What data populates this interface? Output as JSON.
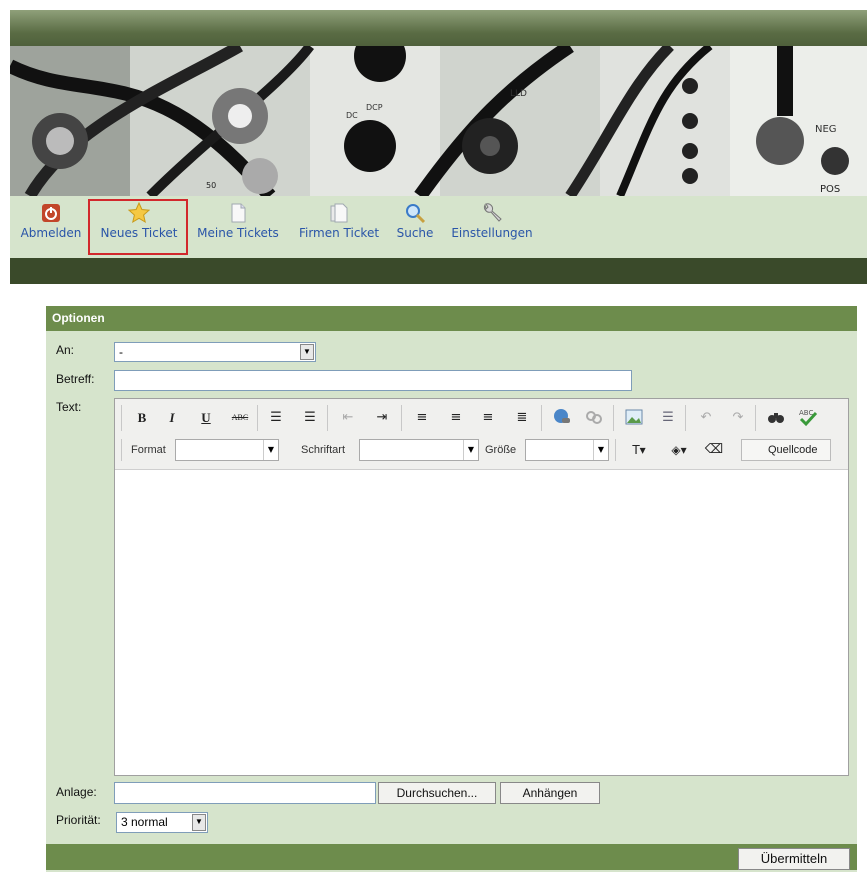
{
  "nav": {
    "items": [
      {
        "label": "Abmelden",
        "icon": "power-icon"
      },
      {
        "label": "Neues Ticket",
        "icon": "star-icon"
      },
      {
        "label": "Meine Tickets",
        "icon": "document-icon"
      },
      {
        "label": "Firmen Ticket",
        "icon": "documents-icon"
      },
      {
        "label": "Suche",
        "icon": "magnifier-icon"
      },
      {
        "label": "Einstellungen",
        "icon": "wrench-icon"
      }
    ],
    "active": "Neues Ticket"
  },
  "banner": {
    "labels": [
      "DC",
      "DCP",
      "LLD",
      "NEG",
      "POS",
      "50"
    ]
  },
  "form": {
    "section_title": "Optionen",
    "an_label": "An:",
    "an_value": "-",
    "betreff_label": "Betreff:",
    "betreff_value": "",
    "text_label": "Text:",
    "editor": {
      "format_label": "Format",
      "font_label": "Schriftart",
      "size_label": "Größe",
      "source_button": "Quellcode"
    },
    "anlage_label": "Anlage:",
    "browse_button": "Durchsuchen...",
    "attach_button": "Anhängen",
    "priority_label": "Priorität:",
    "priority_value": "3 normal",
    "submit_button": "Übermitteln"
  },
  "colors": {
    "header_green": "#6d8c4c",
    "panel_bg": "#d6e4cc",
    "link_blue": "#2a55a8",
    "active_border": "#d2282c"
  }
}
